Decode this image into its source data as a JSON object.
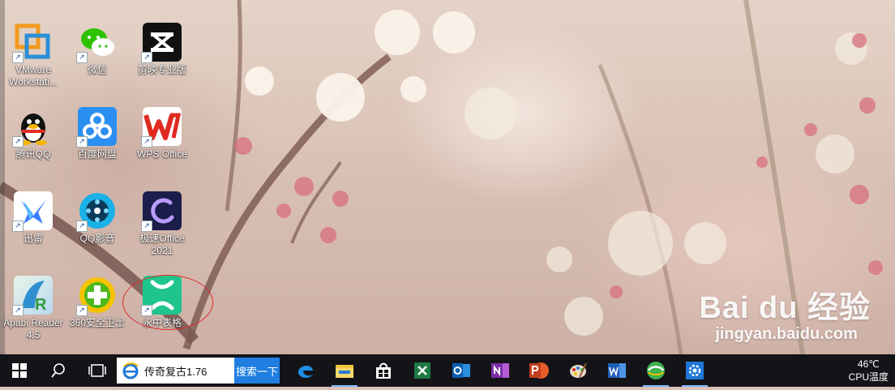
{
  "desktop": {
    "icons": [
      {
        "label": "VMware Workstati..."
      },
      {
        "label": "微信"
      },
      {
        "label": "剪映专业版"
      },
      {
        "label": "腾讯QQ"
      },
      {
        "label": "百度网盘"
      },
      {
        "label": "WPS Office"
      },
      {
        "label": "迅雷"
      },
      {
        "label": "QQ影音"
      },
      {
        "label": "极速Office 2021"
      },
      {
        "label": "Apabi Reader 4.5"
      },
      {
        "label": "360安全卫士"
      },
      {
        "label": "永中表格"
      }
    ],
    "shortcut_glyph": "↗",
    "watermark": {
      "brand": "Bai du 经验",
      "url": "jingyan.baidu.com"
    }
  },
  "taskbar": {
    "search_query": "传奇复古1.76",
    "search_button": "搜索一下",
    "tray": {
      "temp": "46℃",
      "cpu_label": "CPU温度"
    }
  },
  "colors": {
    "taskbar": "#141418",
    "highlight": "#e0282a",
    "search_button": "#1f7ee0"
  }
}
